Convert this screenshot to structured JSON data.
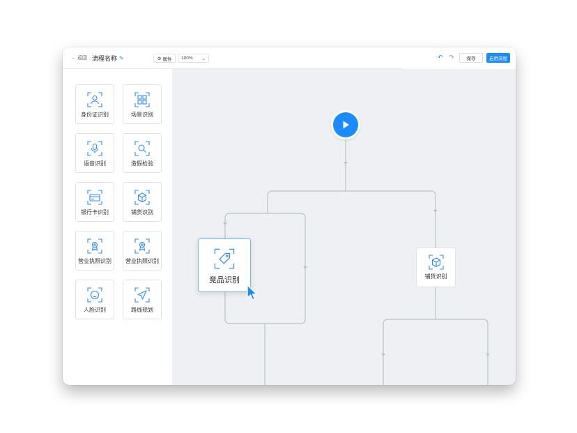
{
  "toolbar": {
    "back_label": "返回",
    "title": "流程名称",
    "properties_label": "属性",
    "zoom_value": "100%",
    "save_label": "保存",
    "enable_label": "启用流程"
  },
  "sidebar": {
    "items": [
      {
        "label": "身份证识别",
        "icon": "id-card-person-icon"
      },
      {
        "label": "场景识别",
        "icon": "scene-grid-icon"
      },
      {
        "label": "语音识别",
        "icon": "microphone-icon"
      },
      {
        "label": "造假检验",
        "icon": "magnifier-icon"
      },
      {
        "label": "银行卡识别",
        "icon": "bank-card-icon"
      },
      {
        "label": "铺货识别",
        "icon": "box-icon"
      },
      {
        "label": "营业执照识别",
        "icon": "license-badge-icon"
      },
      {
        "label": "营业执照识别",
        "icon": "license-badge-icon"
      },
      {
        "label": "人脸识别",
        "icon": "face-icon"
      },
      {
        "label": "路线规划",
        "icon": "navigation-arrow-icon"
      }
    ]
  },
  "canvas": {
    "start_icon": "play-icon",
    "nodes": [
      {
        "label": "竞品识别",
        "icon": "price-tag-icon"
      },
      {
        "label": "铺货识别",
        "icon": "box-icon"
      }
    ]
  },
  "colors": {
    "accent": "#1a8cff",
    "canvas_bg": "#eef0f3",
    "connector": "#b5c3c9"
  }
}
